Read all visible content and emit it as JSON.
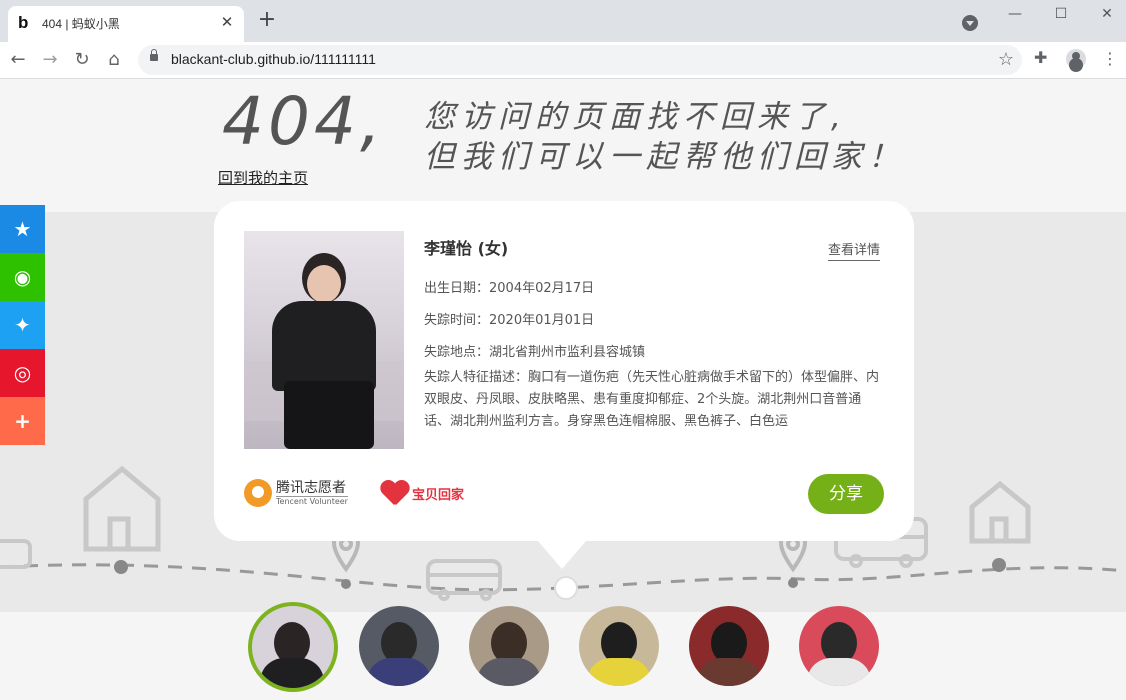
{
  "browser": {
    "tab_title": "404 | 蚂蚁小黑",
    "favicon_letter": "b",
    "url": "blackant-club.github.io/111111111"
  },
  "page": {
    "code": "404,",
    "slogan_line1": "您访问的页面找不回来了,",
    "slogan_line2": "但我们可以一起帮他们回家！",
    "home_link": "回到我的主页"
  },
  "card": {
    "name": "李瑾怡 (女)",
    "detail_link": "查看详情",
    "birth": "出生日期：2004年02月17日",
    "missing_time": "失踪时间：2020年01月01日",
    "missing_place": "失踪地点：湖北省荆州市监利县容城镇",
    "description": "失踪人特征描述：胸口有一道伤疤（先天性心脏病做手术留下的）体型偏胖、内双眼皮、丹凤眼、皮肤略黑、患有重度抑郁症、2个头旋。湖北荆州口音普通话、湖北荆州监利方言。身穿黑色连帽棉服、黑色裤子、白色运",
    "share_label": "分享",
    "logo_tencent_cn": "腾讯志愿者",
    "logo_tencent_en": "Tencent Volunteer",
    "logo_baobei": "宝贝回家"
  },
  "sidebar": {
    "items": [
      {
        "icon": "qzone-icon",
        "glyph": "★",
        "color": "#1b8ae4"
      },
      {
        "icon": "wechat-icon",
        "glyph": "◉",
        "color": "#2dc100"
      },
      {
        "icon": "twitter-icon",
        "glyph": "✦",
        "color": "#1da1f2"
      },
      {
        "icon": "weibo-icon",
        "glyph": "◎",
        "color": "#e6162d"
      },
      {
        "icon": "more-icon",
        "glyph": "+",
        "color": "#ff6b4a"
      }
    ]
  },
  "thumbnails": [
    {
      "bg": "#d8d2da",
      "hair": "#2a2424",
      "shirt": "#1f1f22",
      "active": true
    },
    {
      "bg": "#555a64",
      "hair": "#2a2a2a",
      "shirt": "#3a3f7a",
      "active": false
    },
    {
      "bg": "#a89a86",
      "hair": "#3a2e26",
      "shirt": "#5a5a64",
      "active": false
    },
    {
      "bg": "#c8b89a",
      "hair": "#1e1e1e",
      "shirt": "#e6d23a",
      "active": false
    },
    {
      "bg": "#8a2a2a",
      "hair": "#1a1a1a",
      "shirt": "#6a3a30",
      "active": false
    },
    {
      "bg": "#d94a5a",
      "hair": "#2a2a2a",
      "shirt": "#e8e8e8",
      "active": false
    }
  ],
  "colors": {
    "accent_green": "#76b018",
    "card_bg": "#ffffff",
    "band_bg": "#e9e9e9"
  }
}
